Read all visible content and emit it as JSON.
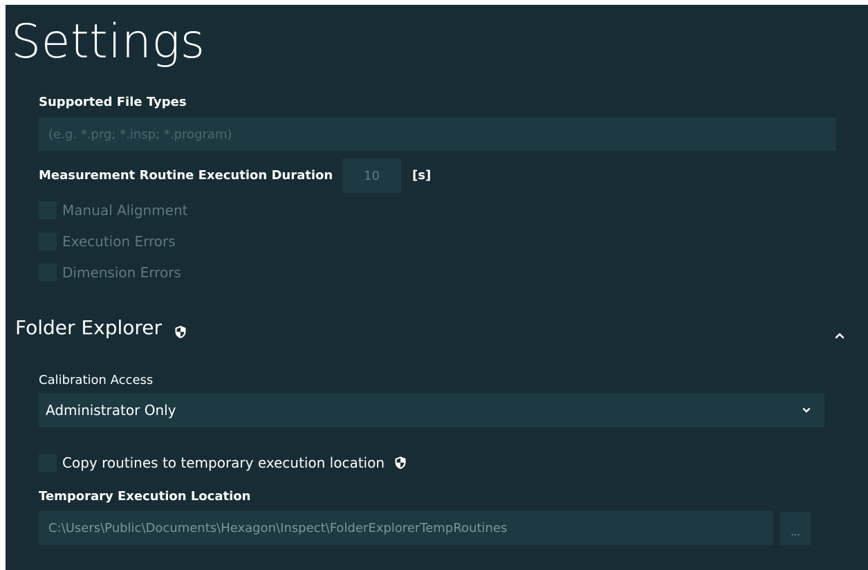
{
  "page": {
    "title": "Settings"
  },
  "file_types": {
    "label": "Supported File Types",
    "placeholder": "(e.g. *.prg; *.insp; *.program)",
    "value": ""
  },
  "execution_duration": {
    "label": "Measurement Routine Execution Duration",
    "value": "10",
    "unit": "[s]"
  },
  "checkboxes": [
    {
      "label": "Manual Alignment",
      "checked": false
    },
    {
      "label": "Execution Errors",
      "checked": false
    },
    {
      "label": "Dimension Errors",
      "checked": false
    }
  ],
  "folder_explorer": {
    "title": "Folder Explorer",
    "shield_icon": "shield-icon",
    "collapse_icon": "chevron-up-icon",
    "calibration_access": {
      "label": "Calibration Access",
      "selected": "Administrator Only",
      "dropdown_icon": "chevron-down-icon"
    },
    "copy_routines": {
      "label": "Copy routines to temporary execution location",
      "checked": false
    },
    "temp_location": {
      "label": "Temporary Execution Location",
      "value": "C:\\Users\\Public\\Documents\\Hexagon\\Inspect\\FolderExplorerTempRoutines",
      "browse_label": "..."
    }
  },
  "colors": {
    "background": "#172c34",
    "field": "#1d3941",
    "text": "#ffffff",
    "muted": "#5c7a82"
  }
}
